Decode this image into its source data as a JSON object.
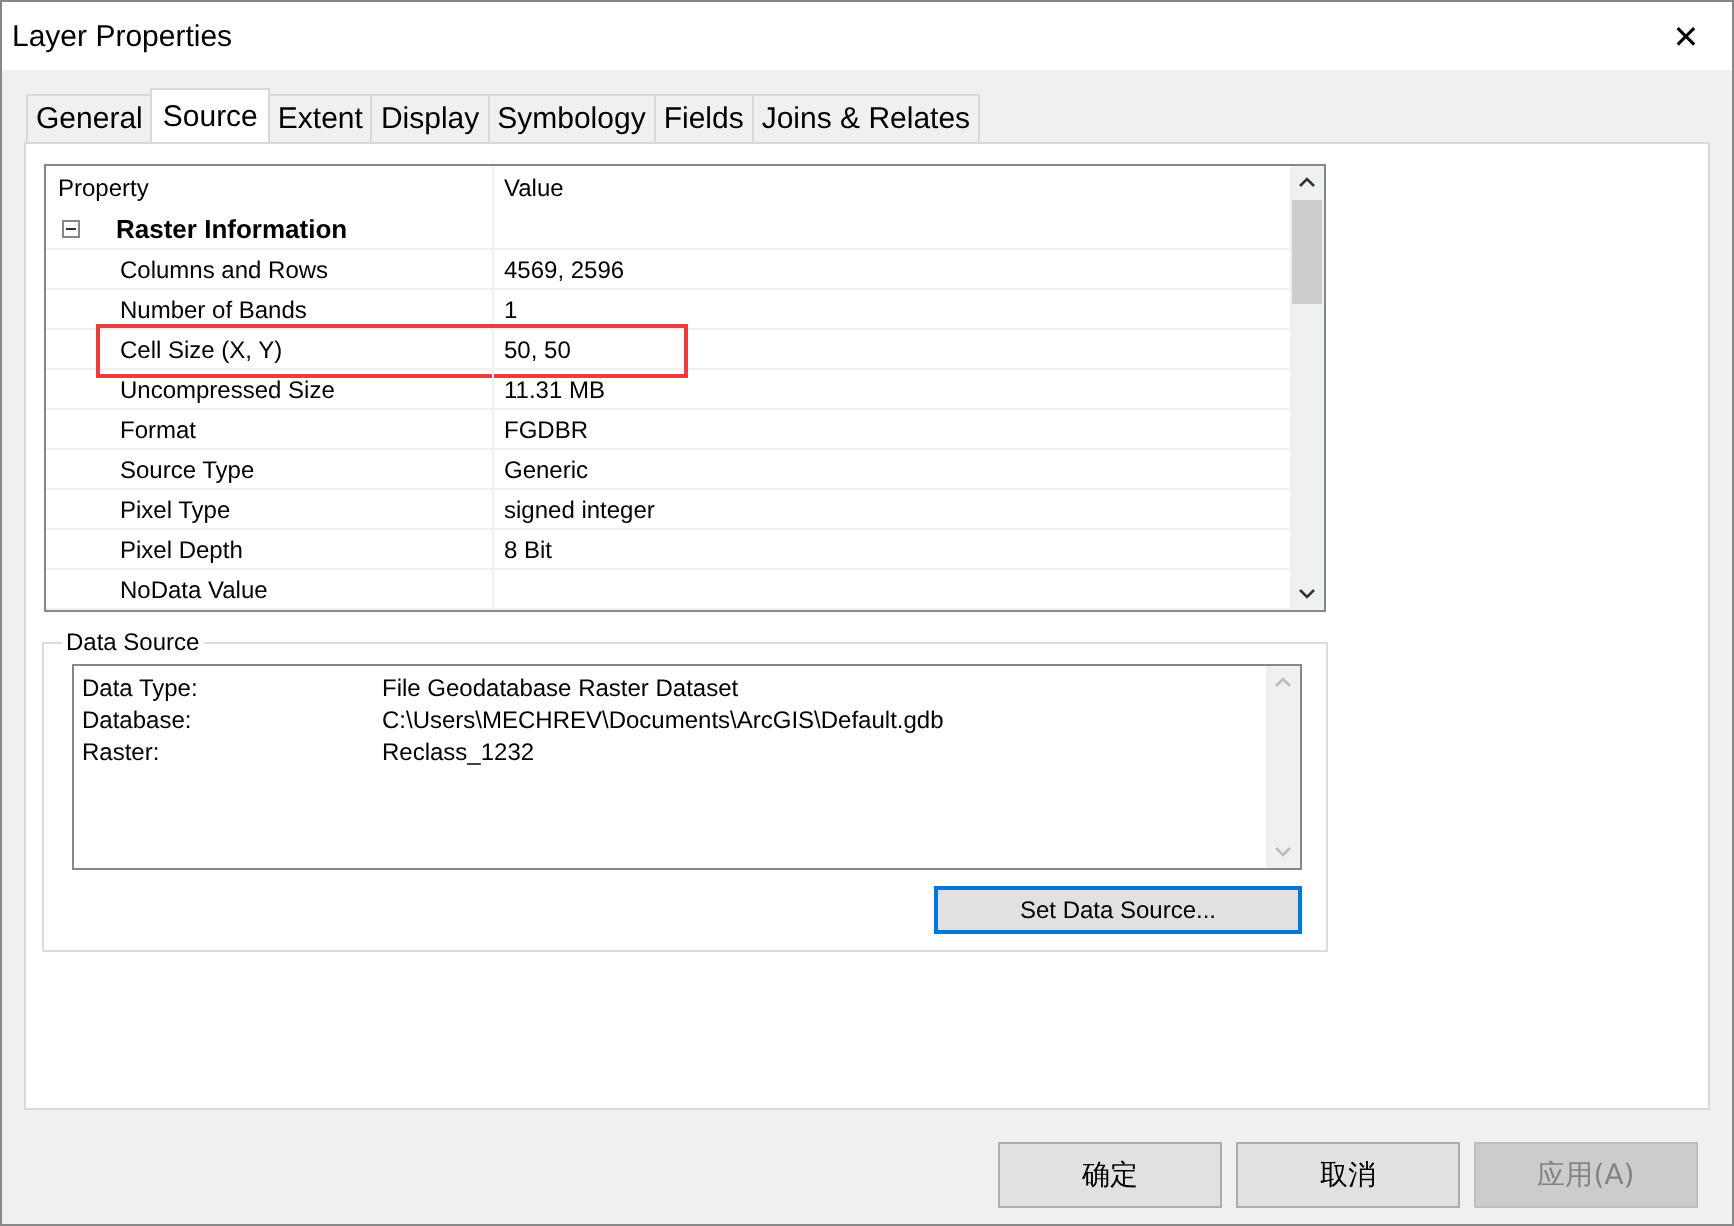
{
  "window": {
    "title": "Layer Properties",
    "close": "✕"
  },
  "tabs": [
    {
      "label": "General",
      "selected": false
    },
    {
      "label": "Source",
      "selected": true
    },
    {
      "label": "Extent",
      "selected": false
    },
    {
      "label": "Display",
      "selected": false
    },
    {
      "label": "Symbology",
      "selected": false
    },
    {
      "label": "Fields",
      "selected": false
    },
    {
      "label": "Joins & Relates",
      "selected": false
    }
  ],
  "grid": {
    "columns": [
      "Property",
      "Value"
    ],
    "group": {
      "label": "Raster Information",
      "expanded": true
    },
    "rows": [
      {
        "property": "Columns and Rows",
        "value": "4569, 2596",
        "highlighted": false
      },
      {
        "property": "Number of Bands",
        "value": "1",
        "highlighted": false
      },
      {
        "property": "Cell Size (X, Y)",
        "value": "50, 50",
        "highlighted": true
      },
      {
        "property": "Uncompressed Size",
        "value": "11.31 MB",
        "highlighted": false
      },
      {
        "property": "Format",
        "value": "FGDBR",
        "highlighted": false
      },
      {
        "property": "Source Type",
        "value": "Generic",
        "highlighted": false
      },
      {
        "property": "Pixel Type",
        "value": "signed integer",
        "highlighted": false
      },
      {
        "property": "Pixel Depth",
        "value": "8 Bit",
        "highlighted": false
      },
      {
        "property": "NoData Value",
        "value": "",
        "highlighted": false
      }
    ]
  },
  "data_source": {
    "title": "Data Source",
    "lines": [
      {
        "label": "Data Type:",
        "value": "File Geodatabase Raster Dataset"
      },
      {
        "label": "Database:",
        "value": "C:\\Users\\MECHREV\\Documents\\ArcGIS\\Default.gdb"
      },
      {
        "label": "Raster:",
        "value": "Reclass_1232"
      }
    ],
    "button": "Set Data Source..."
  },
  "buttons": [
    {
      "label": "确定",
      "disabled": false
    },
    {
      "label": "取消",
      "disabled": false
    },
    {
      "label": "应用(A)",
      "disabled": true
    }
  ]
}
